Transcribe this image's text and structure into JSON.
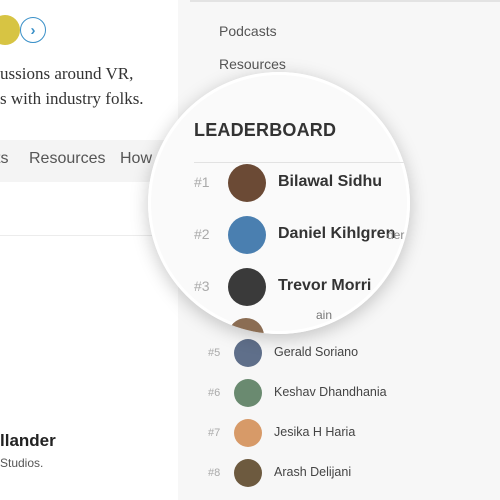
{
  "left": {
    "description_lines": [
      "ussions around VR,",
      "s with industry folks."
    ],
    "tabs": [
      "ts",
      "Resources",
      "How"
    ],
    "featured": {
      "name": "llander",
      "company": "Studios."
    }
  },
  "nav": {
    "items": [
      "Podcasts",
      "Resources"
    ]
  },
  "leaderboard": {
    "title": "LEADERBOARD",
    "top": [
      {
        "rank": "#1",
        "name": "Bilawal Sidhu",
        "avatar_color": "#6b4a35"
      },
      {
        "rank": "#2",
        "name": "Daniel Kihlgren",
        "trailing": "der",
        "avatar_color": "#4a7fb0"
      },
      {
        "rank": "#3",
        "name": "Trevor Morri",
        "avatar_color": "#3a3a3a"
      }
    ],
    "rest": [
      {
        "rank": "#5",
        "name": "Gerald Soriano",
        "avatar_color": "#5f6f8a"
      },
      {
        "rank": "#6",
        "name": "Keshav Dhandhania",
        "avatar_color": "#6a8a70"
      },
      {
        "rank": "#7",
        "name": "Jesika H Haria",
        "avatar_color": "#d79a68"
      },
      {
        "rank": "#8",
        "name": "Arash Delijani",
        "avatar_color": "#6d5a3f"
      }
    ],
    "peek_tail": "ain"
  },
  "colors": {
    "accent": "#3a90c8"
  }
}
